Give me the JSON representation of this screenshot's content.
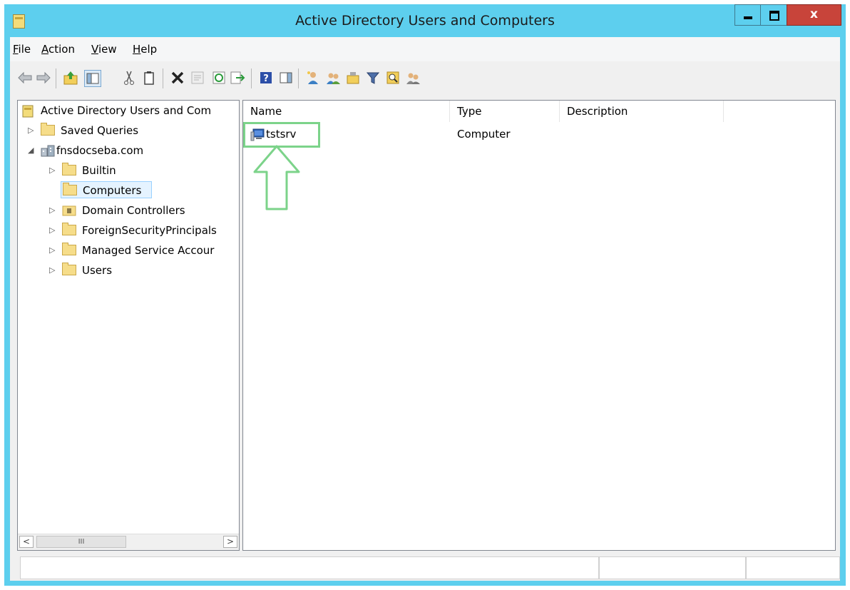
{
  "window": {
    "title": "Active Directory Users and Computers",
    "close_glyph": "x"
  },
  "menu": {
    "file": "File",
    "action": "Action",
    "view": "View",
    "help": "Help"
  },
  "toolbar": {
    "icons": [
      "back-icon",
      "forward-icon",
      "up-folder-icon",
      "show-hide-console-tree-icon",
      "cut-icon",
      "copy-icon",
      "delete-icon",
      "properties-icon",
      "refresh-icon",
      "export-list-icon",
      "help-icon",
      "show-action-pane-icon",
      "new-user-icon",
      "new-group-icon",
      "new-ou-icon",
      "filter-icon",
      "find-icon",
      "add-to-group-icon"
    ]
  },
  "tree": {
    "root": "Active Directory Users and Com",
    "saved_queries": "Saved Queries",
    "domain": "fnsdocseba.com",
    "builtin": "Builtin",
    "computers": "Computers",
    "domain_controllers": "Domain Controllers",
    "fsp": "ForeignSecurityPrincipals",
    "msa": "Managed Service Accour",
    "users": "Users",
    "scroll_thumb": "III"
  },
  "list": {
    "columns": {
      "name": "Name",
      "type": "Type",
      "description": "Description"
    },
    "rows": [
      {
        "name": "tstsrv",
        "type": "Computer",
        "description": ""
      }
    ]
  },
  "colors": {
    "titlebar": "#5dcfee",
    "close_button": "#c8443a",
    "highlight": "#7cd38a",
    "selection": "#e5f3ff"
  }
}
